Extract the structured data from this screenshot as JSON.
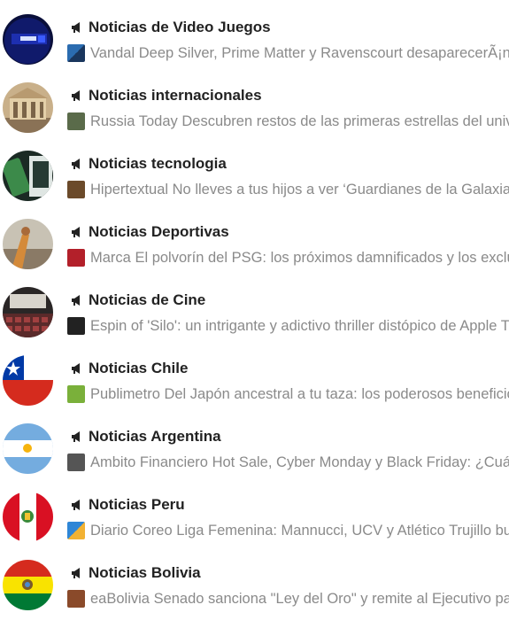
{
  "items": [
    {
      "title": "Noticias de Video Juegos",
      "source": "Vandal",
      "headline": "Deep Silver, Prime Matter y Ravenscourt desaparecerÃ¡n"
    },
    {
      "title": "Noticias internacionales",
      "source": "Russia Today",
      "headline": "Descubren restos de las primeras estrellas del universo"
    },
    {
      "title": "Noticias tecnologia",
      "source": "Hipertextual",
      "headline": "No lleves a tus hijos a ver ‘Guardianes de la Galaxia"
    },
    {
      "title": "Noticias Deportivas",
      "source": "Marca",
      "headline": "El polvorín del PSG: los próximos damnificados y los excluidos"
    },
    {
      "title": "Noticias de Cine",
      "source": "Espin of",
      "headline": "'Silo': un intrigante y adictivo thriller distópico de Apple TV+"
    },
    {
      "title": "Noticias Chile",
      "source": "Publimetro",
      "headline": "Del Japón ancestral a tu taza: los poderosos beneficios"
    },
    {
      "title": "Noticias Argentina",
      "source": "Ambito Financiero",
      "headline": "Hot Sale, Cyber Monday y Black Friday: ¿Cuál"
    },
    {
      "title": "Noticias Peru",
      "source": "Diario Coreo",
      "headline": "Liga Femenina: Mannucci, UCV y Atlético Trujillo buscan"
    },
    {
      "title": "Noticias Bolivia",
      "source": "eaBolivia",
      "headline": "Senado sanciona \"Ley del Oro\" y remite al Ejecutivo para"
    }
  ],
  "icons": {
    "category": "megaphone-icon",
    "avatars": [
      "video-games-icon",
      "international-icon",
      "technology-icon",
      "sports-icon",
      "cinema-icon",
      "chile-flag-icon",
      "argentina-flag-icon",
      "peru-flag-icon",
      "bolivia-flag-icon"
    ]
  },
  "colors": {
    "title": "#222222",
    "subtitle": "#8a8a8a"
  }
}
